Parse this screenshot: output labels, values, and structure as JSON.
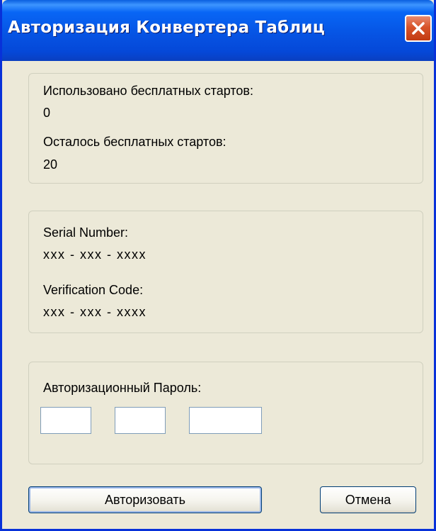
{
  "window": {
    "title": "Авторизация Конвертера Таблиц"
  },
  "usage": {
    "used_label": "Использовано бесплатных стартов:",
    "used_value": "0",
    "remaining_label": "Осталось бесплатных стартов:",
    "remaining_value": "20"
  },
  "codes": {
    "serial_label": "Serial Number:",
    "serial_value": "xxx - xxx - xxxx",
    "verification_label": "Verification Code:",
    "verification_value": "xxx - xxx - xxxx"
  },
  "password": {
    "label": "Авторизационный Пароль:",
    "field1_value": "",
    "field2_value": "",
    "field3_value": ""
  },
  "buttons": {
    "authorize_label": "Авторизовать",
    "cancel_label": "Отмена"
  },
  "colors": {
    "titlebar": "#0654e4",
    "window_bg": "#ece9d8",
    "close_button": "#d8542a"
  },
  "icons": {
    "close": "close-icon"
  }
}
